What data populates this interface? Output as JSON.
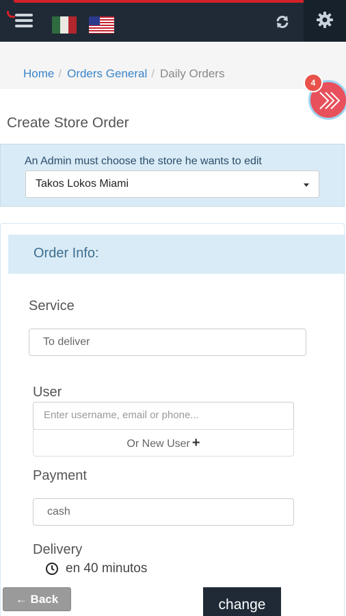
{
  "header": {
    "menu_icon": "menu-icon",
    "flags": [
      "flag-mexico",
      "flag-usa"
    ],
    "refresh_icon": "refresh-icon",
    "settings_icon": "gear-icon",
    "colors": {
      "bar": "#1f2a36",
      "accent": "#d32027"
    }
  },
  "breadcrumb": {
    "items": [
      "Home",
      "Orders General",
      "Daily Orders"
    ],
    "separator": "/"
  },
  "floating_button": {
    "badge": "4",
    "icon": "double-chevron-right-icon",
    "color": "#e8505b"
  },
  "page_title": "Create Store Order",
  "admin_selector": {
    "note": "An Admin must choose the store he wants to edit",
    "selected_store": "Takos Lokos Miami"
  },
  "order_info": {
    "heading": "Order Info:",
    "service": {
      "label": "Service",
      "value": "To deliver"
    },
    "user": {
      "label": "User",
      "placeholder": "Enter username, email or phone...",
      "new_user_label": "Or New User",
      "new_user_icon": "+"
    },
    "payment": {
      "label": "Payment",
      "value": "cash"
    },
    "delivery": {
      "label": "Delivery",
      "time": "en 40 minutos",
      "icon": "clock-icon"
    }
  },
  "actions": {
    "back_label": "Back",
    "back_icon": "arrow-left-icon",
    "change_label": "change"
  }
}
